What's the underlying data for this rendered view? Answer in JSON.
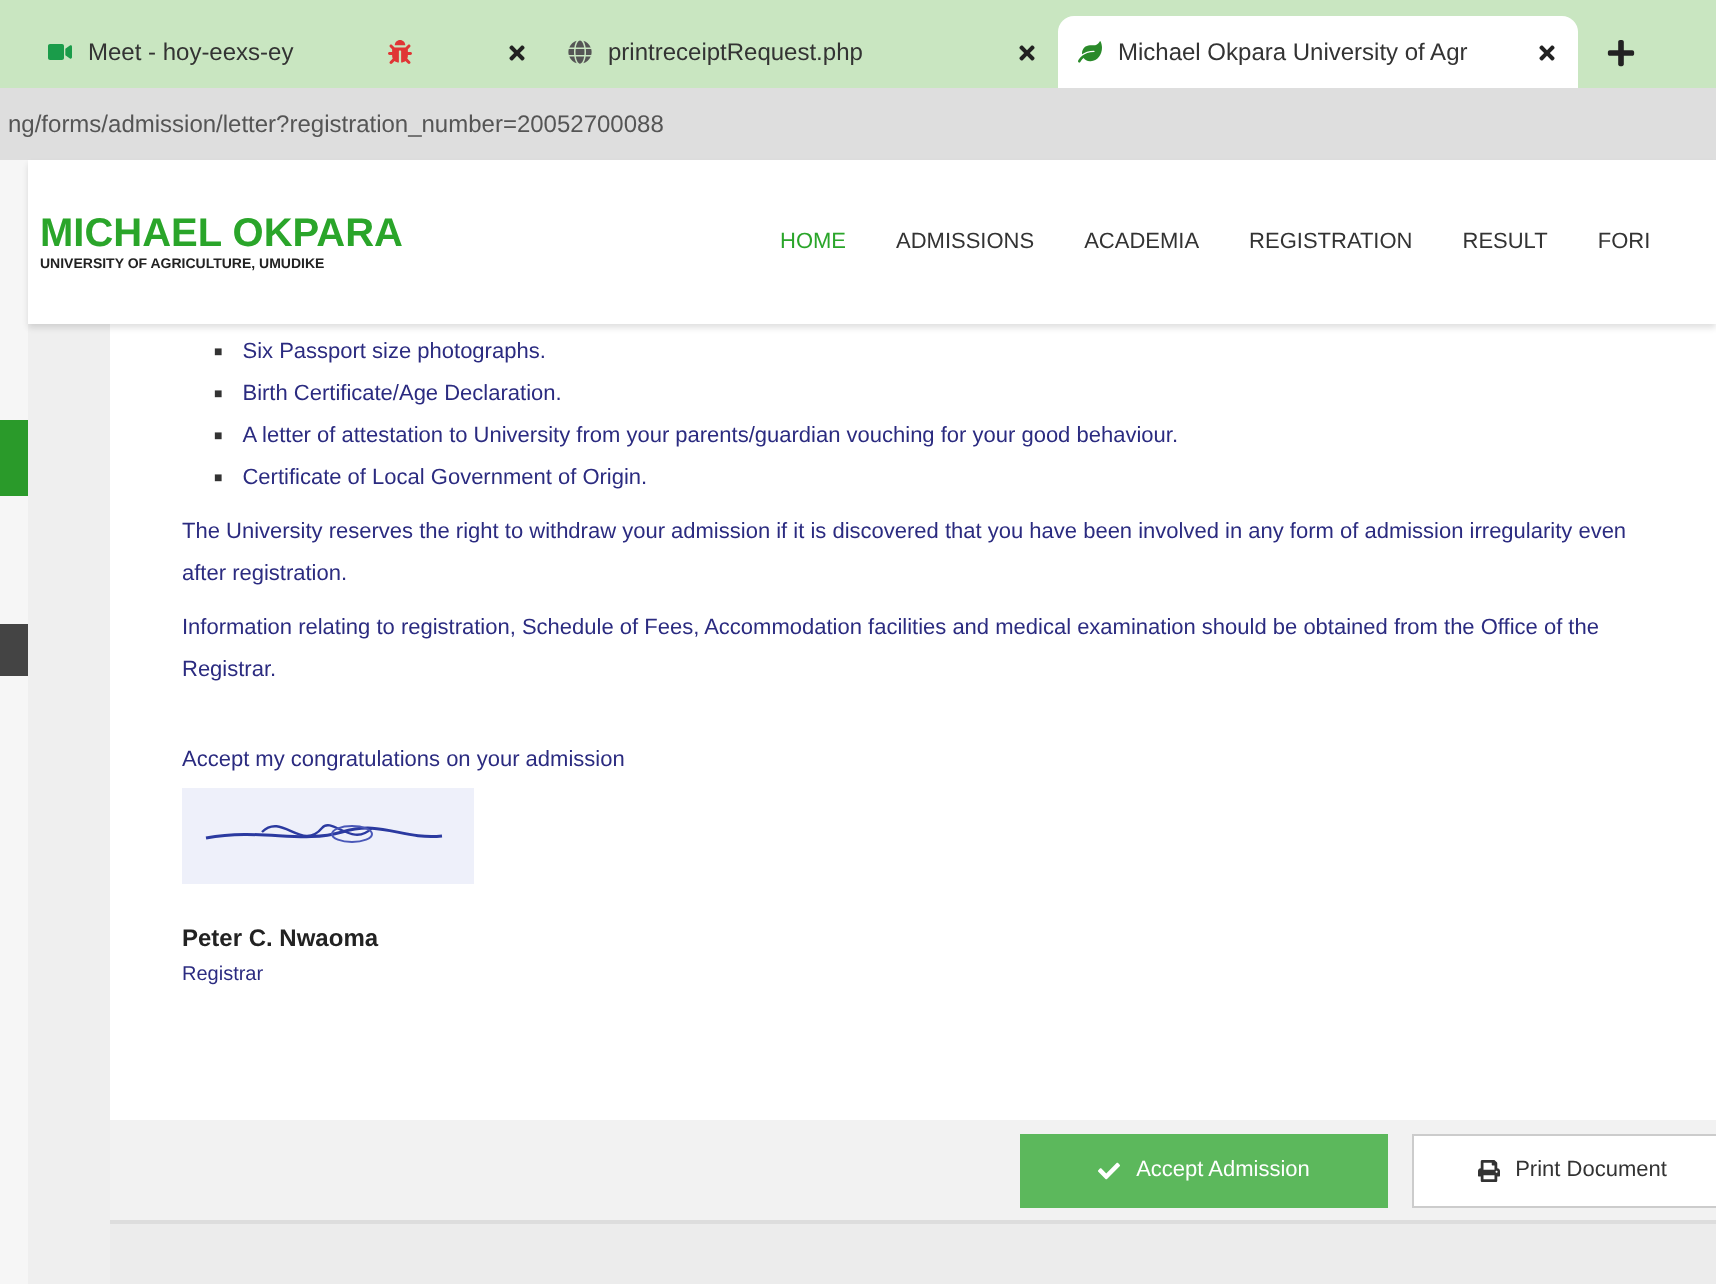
{
  "browser": {
    "tabs": [
      {
        "title": "Meet - hoy-eexs-ey",
        "kind": "meet",
        "selected": false
      },
      {
        "kind": "pinned",
        "selected": false
      },
      {
        "title": "printreceiptRequest.php",
        "kind": "globe",
        "selected": false
      },
      {
        "title": "Michael Okpara University of Agr",
        "kind": "site",
        "selected": true
      }
    ],
    "url": "ng/forms/admission/letter?registration_number=20052700088"
  },
  "header": {
    "logo_title": "MICHAEL OKPARA",
    "logo_subtitle": "UNIVERSITY OF AGRICULTURE, UMUDIKE",
    "nav": [
      {
        "label": "HOME",
        "selected": true
      },
      {
        "label": "ADMISSIONS",
        "selected": false
      },
      {
        "label": "ACADEMIA",
        "selected": false
      },
      {
        "label": "REGISTRATION",
        "selected": false
      },
      {
        "label": "RESULT",
        "selected": false
      },
      {
        "label": "FORI",
        "selected": false
      }
    ]
  },
  "letter": {
    "requirements": [
      {
        "bullet": "■",
        "text": "Six Passport size photographs."
      },
      {
        "bullet": "■",
        "text": "Birth Certificate/Age Declaration."
      },
      {
        "bullet": "■",
        "text": "A letter of attestation to University from your parents/guardian vouching for your good behaviour."
      },
      {
        "bullet": "■",
        "text": "Certificate of Local Government of Origin."
      }
    ],
    "paragraphs": [
      "The University reserves the right to withdraw your admission if it is discovered that you have been involved in any form of admission irregularity even after registration.",
      "Information relating to registration, Schedule of Fees, Accommodation facilities and medical examination should be obtained from the Office of the Registrar."
    ],
    "closing": "Accept my congratulations on your admission",
    "signatory": "Peter C. Nwaoma",
    "role": "Registrar"
  },
  "actions": [
    {
      "label": "Accept Admission",
      "kind": "primary"
    },
    {
      "label": "Print Document",
      "kind": "secondary"
    }
  ]
}
